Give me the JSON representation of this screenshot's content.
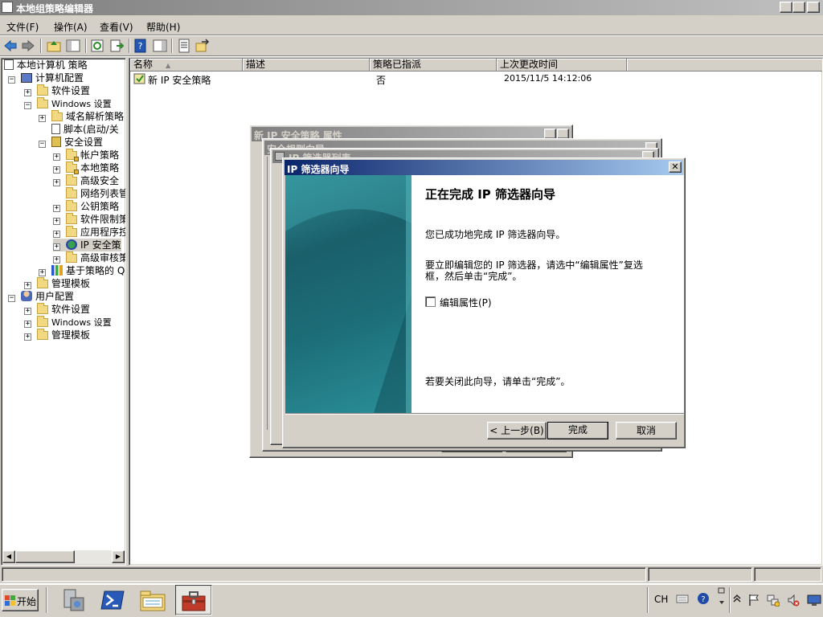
{
  "window": {
    "title": "本地组策略编辑器",
    "controls": [
      "_",
      "□",
      "×"
    ]
  },
  "menu": [
    "文件(F)",
    "操作(A)",
    "查看(V)",
    "帮助(H)"
  ],
  "tree": {
    "root": "本地计算机 策略",
    "items": [
      {
        "label": "计算机配置",
        "expander": "⊟"
      },
      {
        "label": "软件设置",
        "expander": "⊞"
      },
      {
        "label": "Windows 设置",
        "expander": "⊟"
      },
      {
        "label": "域名解析策略",
        "expander": "⊞"
      },
      {
        "label": "脚本(启动/关",
        "expander": ""
      },
      {
        "label": "安全设置",
        "expander": "⊟"
      },
      {
        "label": "帐户策略",
        "expander": "⊞"
      },
      {
        "label": "本地策略",
        "expander": "⊞"
      },
      {
        "label": "高级安全",
        "expander": "⊞"
      },
      {
        "label": "网络列表管",
        "expander": ""
      },
      {
        "label": "公钥策略",
        "expander": "⊞"
      },
      {
        "label": "软件限制策",
        "expander": "⊞"
      },
      {
        "label": "应用程序控",
        "expander": "⊞"
      },
      {
        "label": "IP 安全策",
        "expander": "⊞"
      },
      {
        "label": "高级审核策",
        "expander": "⊞"
      },
      {
        "label": "基于策略的 Q",
        "expander": "⊞"
      },
      {
        "label": "管理模板",
        "expander": "⊞"
      },
      {
        "label": "用户配置",
        "expander": "⊟"
      },
      {
        "label": "软件设置",
        "expander": "⊞"
      },
      {
        "label": "Windows 设置",
        "expander": "⊞"
      },
      {
        "label": "管理模板",
        "expander": "⊞"
      }
    ]
  },
  "list": {
    "columns": [
      "名称",
      "描述",
      "策略已指派",
      "上次更改时间"
    ],
    "rows": [
      {
        "name": "新 IP 安全策略",
        "desc": "",
        "assigned": "否",
        "modified": "2015/11/5 14:12:06"
      }
    ]
  },
  "bg_dialogs": {
    "props_title": "新 IP 安全策略 属性",
    "rule_wizard_title": "安全规则向导",
    "filter_list_title": "IP 筛选器列表"
  },
  "wizard": {
    "title": "IP 筛选器向导",
    "heading": "正在完成 IP 筛选器向导",
    "line1": "您已成功地完成 IP 筛选器向导。",
    "line2a": "要立即编辑您的 IP 筛选器，请选中“编辑属性”复选",
    "line2b": "框，然后单击“完成”。",
    "checkbox_label": "编辑属性(P)",
    "checkbox_checked": false,
    "line3": "若要关闭此向导，请单击“完成”。",
    "back_label": "< 上一步(B)",
    "finish_label": "完成",
    "cancel_label": "取消"
  },
  "taskbar": {
    "start_label": "开始",
    "lang": "CH"
  },
  "colors": {
    "active_title": "#0a246a",
    "inactive_title": "#808080",
    "face": "#d4d0c8",
    "wizard_side": "#1f7e88"
  }
}
